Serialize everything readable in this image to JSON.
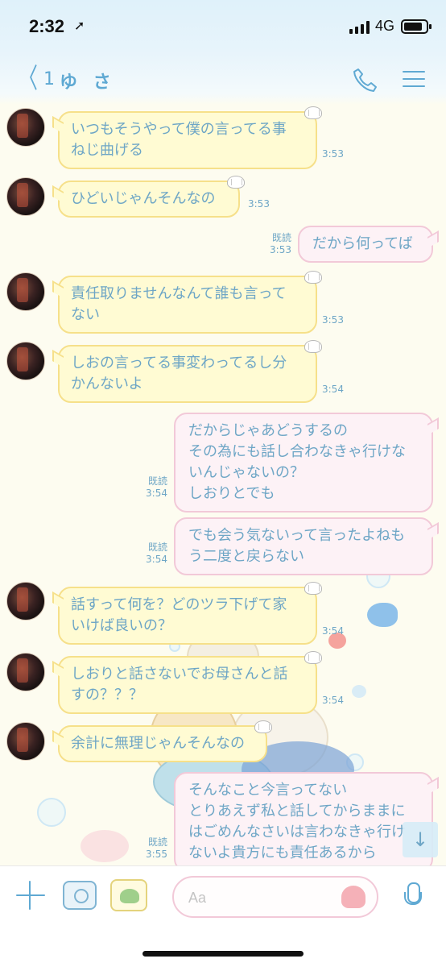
{
  "status_bar": {
    "time": "2:32",
    "network": "4G"
  },
  "header": {
    "back_chevron": "〈",
    "unread_count": "1",
    "title": "ゆ さ"
  },
  "messages": [
    {
      "id": "m1",
      "side": "in",
      "text": "いつもそうやって僕の言ってる事\nねじ曲げる",
      "time": "3:53"
    },
    {
      "id": "m2",
      "side": "in",
      "text": "ひどいじゃんそんなの",
      "time": "3:53"
    },
    {
      "id": "m3",
      "side": "out",
      "text": "だから何ってば",
      "read": "既読",
      "time": "3:53"
    },
    {
      "id": "m4",
      "side": "in",
      "text": "責任取りませんなんて誰も言って\nない",
      "time": "3:53"
    },
    {
      "id": "m5",
      "side": "in",
      "text": "しおの言ってる事変わってるし分\nかんないよ",
      "time": "3:54"
    },
    {
      "id": "m6",
      "side": "out",
      "text": "だからじゃあどうするの\nその為にも話し合わなきゃ行けな\nいんじゃないの？\nしおりとでも",
      "read": "既読",
      "time": "3:54"
    },
    {
      "id": "m7",
      "side": "out",
      "text": "でも会う気ないって言ったよねも\nう二度と戻らない",
      "read": "既読",
      "time": "3:54"
    },
    {
      "id": "m8",
      "side": "in",
      "text": "話すって何を？どのツラ下げて家\nいけば良いの？",
      "time": "3:54"
    },
    {
      "id": "m9",
      "side": "in",
      "text": "しおりと話さないでお母さんと話\nすの？？？",
      "time": "3:54"
    },
    {
      "id": "m10",
      "side": "in",
      "text": "余計に無理じゃんそんなの",
      "time": ""
    },
    {
      "id": "m11",
      "side": "out",
      "text": "そんなこと今言ってない\nとりあえず私と話してからままに\nはごめんなさいは言わなきゃ行け\nないよ貴方にも責任あるから",
      "read": "既読",
      "time": "3:55"
    }
  ],
  "input_bar": {
    "placeholder": "Aa"
  },
  "icons": {
    "back": "chevron-left-icon",
    "call": "phone-icon",
    "menu": "menu-icon",
    "plus": "plus-icon",
    "camera": "camera-icon",
    "sticker": "sticker-icon",
    "emoji": "jellyfish-icon",
    "mic": "microphone-icon",
    "scroll": "arrow-down-icon"
  },
  "colors": {
    "accent": "#5fa9d3",
    "text": "#6ea6c6",
    "incoming_bubble": "#fffbd3",
    "incoming_border": "#f6e08a",
    "outgoing_bubble": "#fdf2f6",
    "outgoing_border": "#f2c9d8",
    "background": "#fdfcf0"
  }
}
